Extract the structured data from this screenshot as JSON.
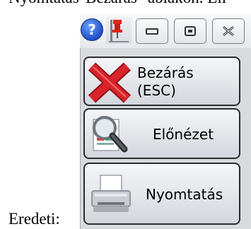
{
  "context": {
    "top_text_fragment": "Nyomtatás\"Bezárás\" ablakon. Ell",
    "bottom_label": "Eredeti:"
  },
  "window": {
    "titlebar": {
      "help_label": "?",
      "minimize_icon": "minimize-icon",
      "restore_icon": "restore-icon",
      "close_icon": "close-icon",
      "pin_icon": "pin-icon"
    },
    "buttons": [
      {
        "line1": "Bezárás",
        "line2": "(ESC)",
        "icon": "red-x-icon"
      },
      {
        "label": "Előnézet",
        "icon": "magnifier-icon"
      },
      {
        "label": "Nyomtatás",
        "icon": "printer-icon"
      }
    ]
  },
  "colors": {
    "close_x": "#d9232a",
    "button_border": "#2a2b2e",
    "panel_bg": "#d9dadc"
  }
}
